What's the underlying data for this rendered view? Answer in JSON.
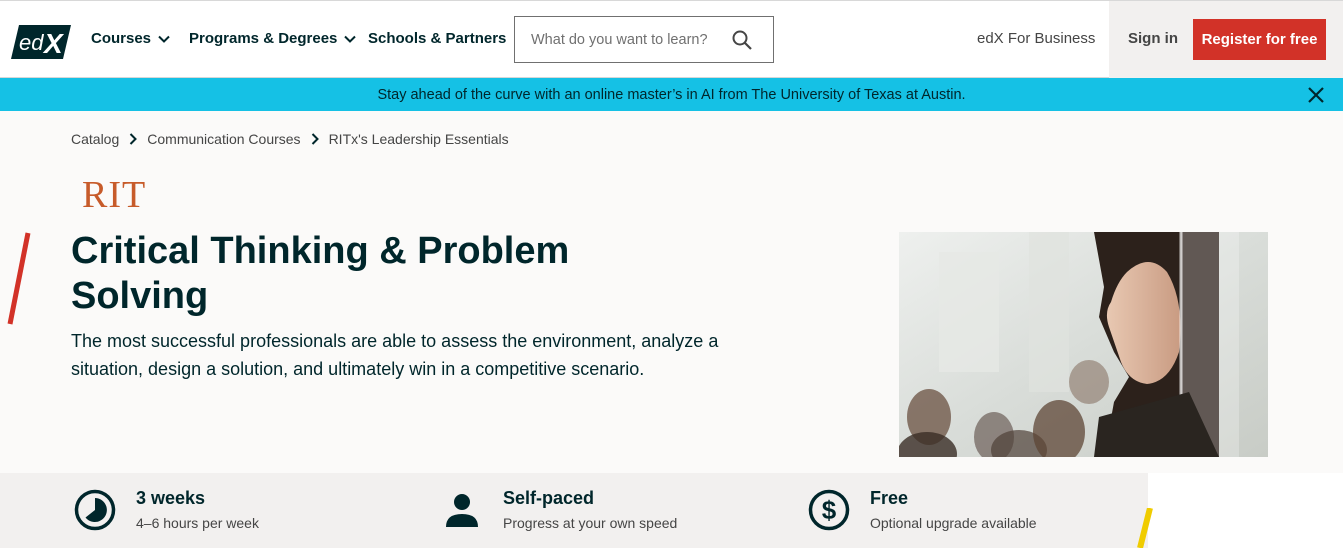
{
  "header": {
    "logo_alt": "edX",
    "nav": [
      {
        "label": "Courses",
        "has_dropdown": true
      },
      {
        "label": "Programs & Degrees",
        "has_dropdown": true
      },
      {
        "label": "Schools & Partners",
        "has_dropdown": false
      }
    ],
    "search_placeholder": "What do you want to learn?",
    "business_link": "edX For Business",
    "signin_label": "Sign in",
    "register_label": "Register for free"
  },
  "banner": {
    "text": "Stay ahead of the curve with an online master’s in AI from The University of Texas at Austin."
  },
  "breadcrumb": [
    "Catalog",
    "Communication Courses",
    "RITx's Leadership Essentials"
  ],
  "org_logo_text": "RIT",
  "course": {
    "title": "Critical Thinking & Problem Solving",
    "description": "The most successful professionals are able to assess the environment, analyze a situation, design a solution, and ultimately win in a competitive scenario."
  },
  "stats": [
    {
      "title": "3 weeks",
      "subtitle": "4–6 hours per week",
      "icon": "clock-icon"
    },
    {
      "title": "Self-paced",
      "subtitle": "Progress at your own speed",
      "icon": "person-icon"
    },
    {
      "title": "Free",
      "subtitle": "Optional upgrade available",
      "icon": "dollar-icon"
    }
  ],
  "colors": {
    "brand_dark": "#00262b",
    "register_red": "#d23228",
    "banner_cyan": "#15c1e5",
    "rit_orange": "#c75b2a",
    "accent_yellow": "#f0cc00"
  }
}
